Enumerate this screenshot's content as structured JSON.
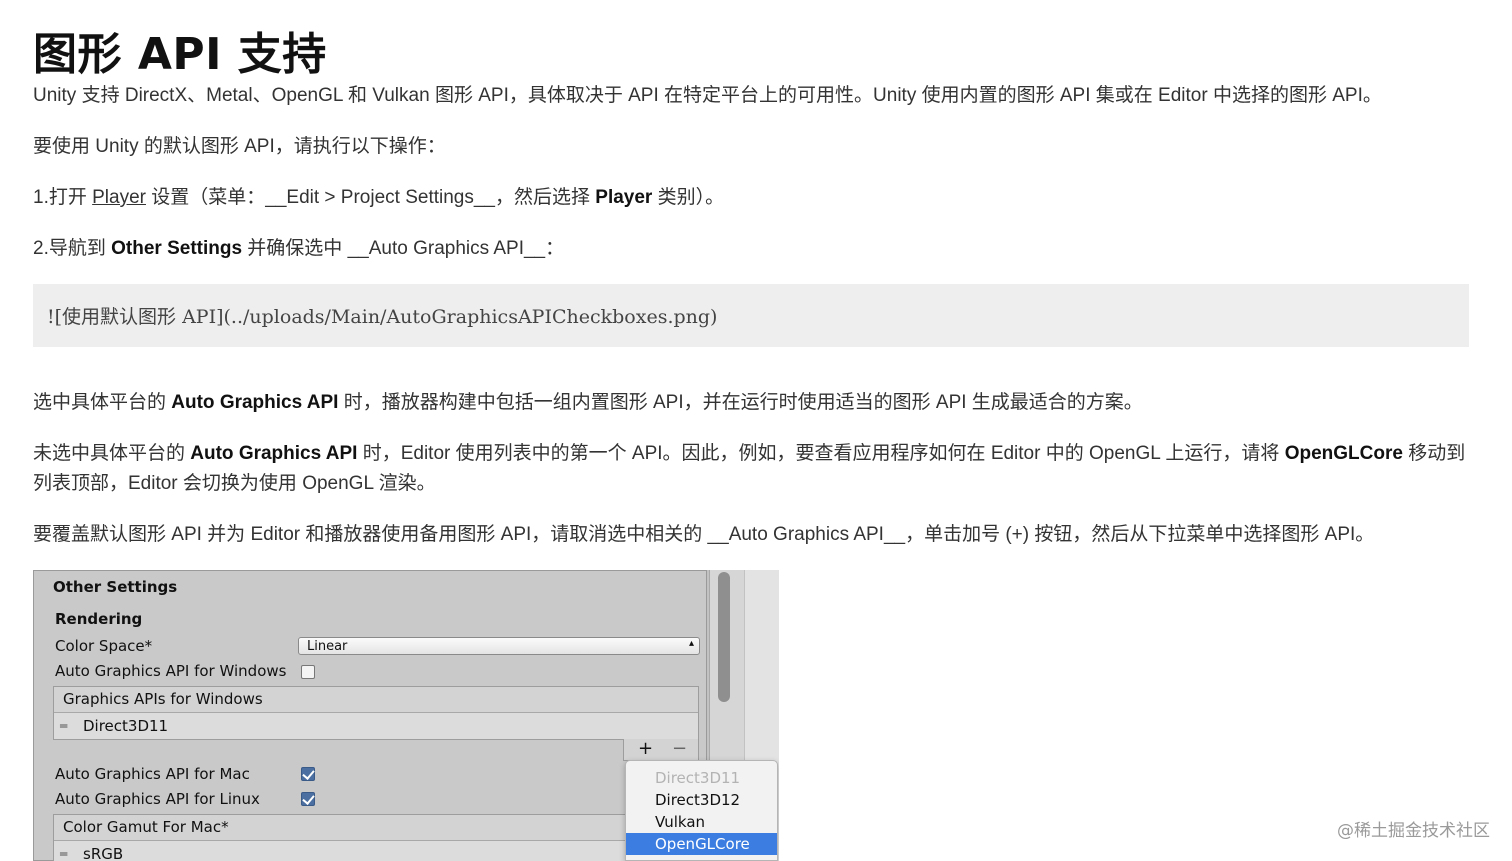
{
  "title": "图形 API 支持",
  "p1": "Unity 支持 DirectX、Metal、OpenGL 和 Vulkan 图形 API，具体取决于 API 在特定平台上的可用性。Unity 使用内置的图形 API 集或在 Editor 中选择的图形 API。",
  "p2": "要使用 Unity 的默认图形 API，请执行以下操作：",
  "step1": {
    "a": "1.打开 ",
    "link": "Player",
    "b": " 设置（菜单：__Edit > Project Settings__，然后选择 ",
    "bold": "Player",
    "c": " 类别）。"
  },
  "step2": {
    "a": "2.导航到 ",
    "bold": "Other Settings",
    "b": " 并确保选中 __Auto Graphics API__："
  },
  "code": "![使用默认图形 API](../uploads/Main/AutoGraphicsAPICheckboxes.png)",
  "p3": {
    "a": "选中具体平台的 ",
    "bold": "Auto Graphics API",
    "b": " 时，播放器构建中包括一组内置图形 API，并在运行时使用适当的图形 API 生成最适合的方案。"
  },
  "p4": {
    "a": "未选中具体平台的 ",
    "bold": "Auto Graphics API",
    "b": " 时，Editor 使用列表中的第一个 API。因此，例如，要查看应用程序如何在 Editor 中的 OpenGL 上运行，请将 ",
    "bold2": "OpenGLCore",
    "c": " 移动到列表顶部，Editor 会切换为使用 OpenGL 渲染。"
  },
  "p5": "要覆盖默认图形 API 并为 Editor 和播放器使用备用图形 API，请取消选中相关的 __Auto Graphics API__，单击加号 (+) 按钮，然后从下拉菜单中选择图形 API。",
  "panel": {
    "header": "Other Settings",
    "section": "Rendering",
    "color_space_label": "Color Space*",
    "color_space_value": "Linear",
    "auto_windows_label": "Auto Graphics API  for Windows",
    "auto_windows_checked": false,
    "apis_windows_header": "Graphics APIs for Windows",
    "apis_windows_item": "Direct3D11",
    "plus": "+",
    "minus": "−",
    "auto_mac_label": "Auto Graphics API  for Mac",
    "auto_mac_checked": true,
    "auto_linux_label": "Auto Graphics API  for Linux",
    "auto_linux_checked": true,
    "gamut_header": "Color Gamut For Mac*",
    "gamut_item": "sRGB",
    "popup": [
      {
        "label": "Direct3D11",
        "state": "disabled"
      },
      {
        "label": "Direct3D12",
        "state": "normal"
      },
      {
        "label": "Vulkan",
        "state": "normal"
      },
      {
        "label": "OpenGLCore",
        "state": "selected"
      }
    ]
  },
  "watermark": "@稀土掘金技术社区"
}
